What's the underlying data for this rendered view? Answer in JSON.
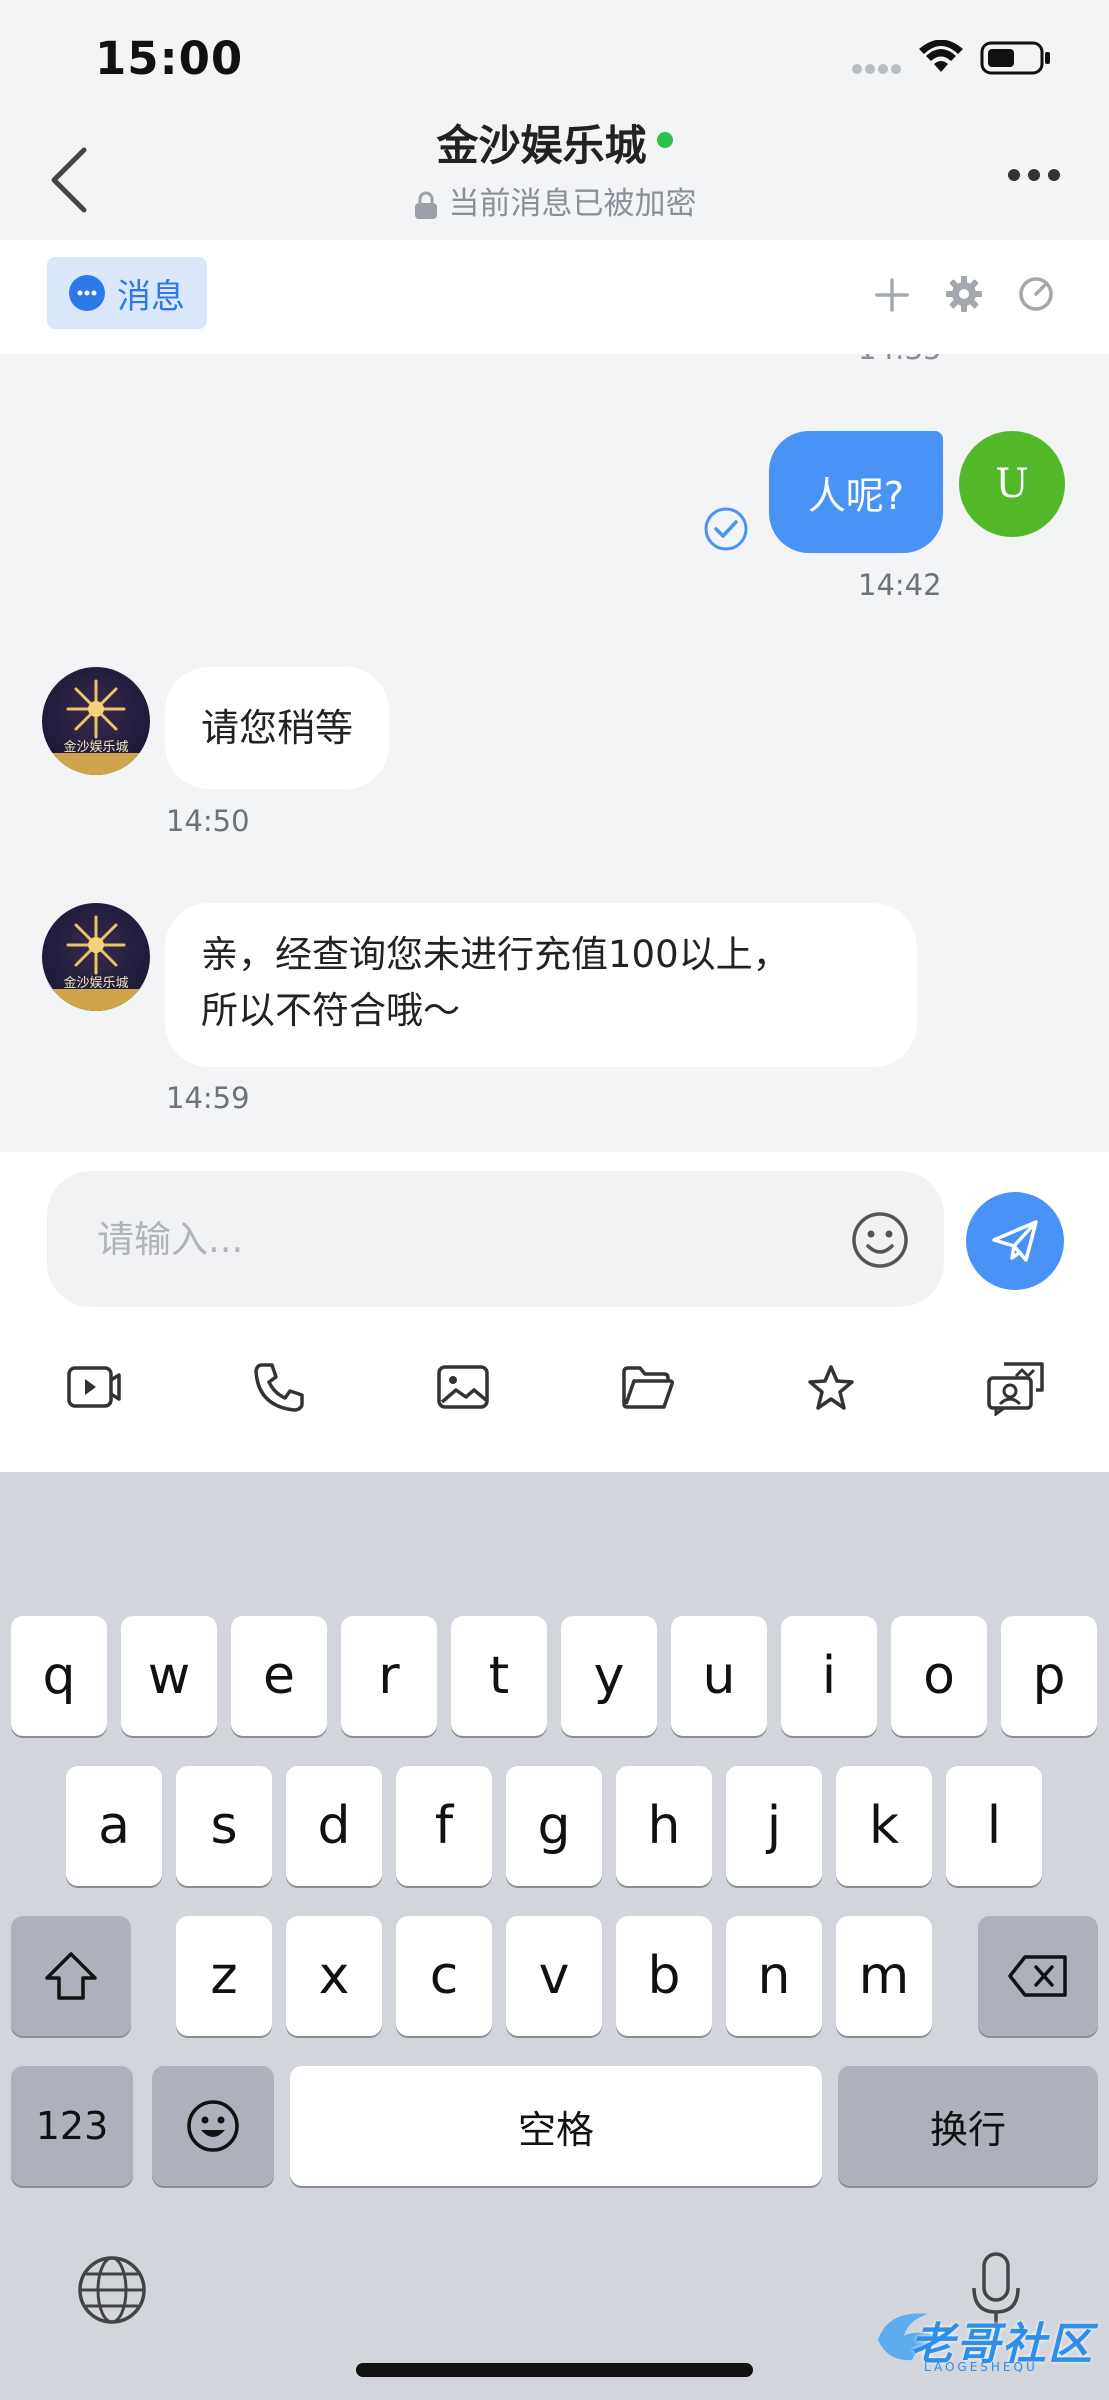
{
  "status_bar": {
    "time": "15:00"
  },
  "header": {
    "title": "金沙娱乐城",
    "encryption_notice": "当前消息已被加密",
    "tab_label": "消息"
  },
  "messages": [
    {
      "direction": "out",
      "sender_initial": "U",
      "text": "人呢?",
      "time": "14:42",
      "status": "read"
    },
    {
      "direction": "in",
      "avatar_text": "金沙娱乐城",
      "text": "请您稍等",
      "time": "14:50"
    },
    {
      "direction": "in",
      "avatar_text": "金沙娱乐城",
      "text_line1": "亲，经查询您未进行充值100以上，",
      "text_line2": "所以不符合哦～",
      "time": "14:59"
    }
  ],
  "composer": {
    "placeholder": "请输入...",
    "tools": [
      "video-icon",
      "phone-icon",
      "image-icon",
      "folder-icon",
      "star-icon",
      "screenshot-chat-icon"
    ]
  },
  "keyboard": {
    "row1": [
      "q",
      "w",
      "e",
      "r",
      "t",
      "y",
      "u",
      "i",
      "o",
      "p"
    ],
    "row2": [
      "a",
      "s",
      "d",
      "f",
      "g",
      "h",
      "j",
      "k",
      "l"
    ],
    "row3": [
      "z",
      "x",
      "c",
      "v",
      "b",
      "n",
      "m"
    ],
    "numbers_key": "123",
    "space_key": "空格",
    "return_key": "换行"
  },
  "watermark": {
    "text": "老哥社区",
    "subtext": "LAOGESHEQU"
  },
  "colors": {
    "accent": "#4a93f6",
    "online": "#2cc04b",
    "user_avatar": "#52b82a"
  }
}
